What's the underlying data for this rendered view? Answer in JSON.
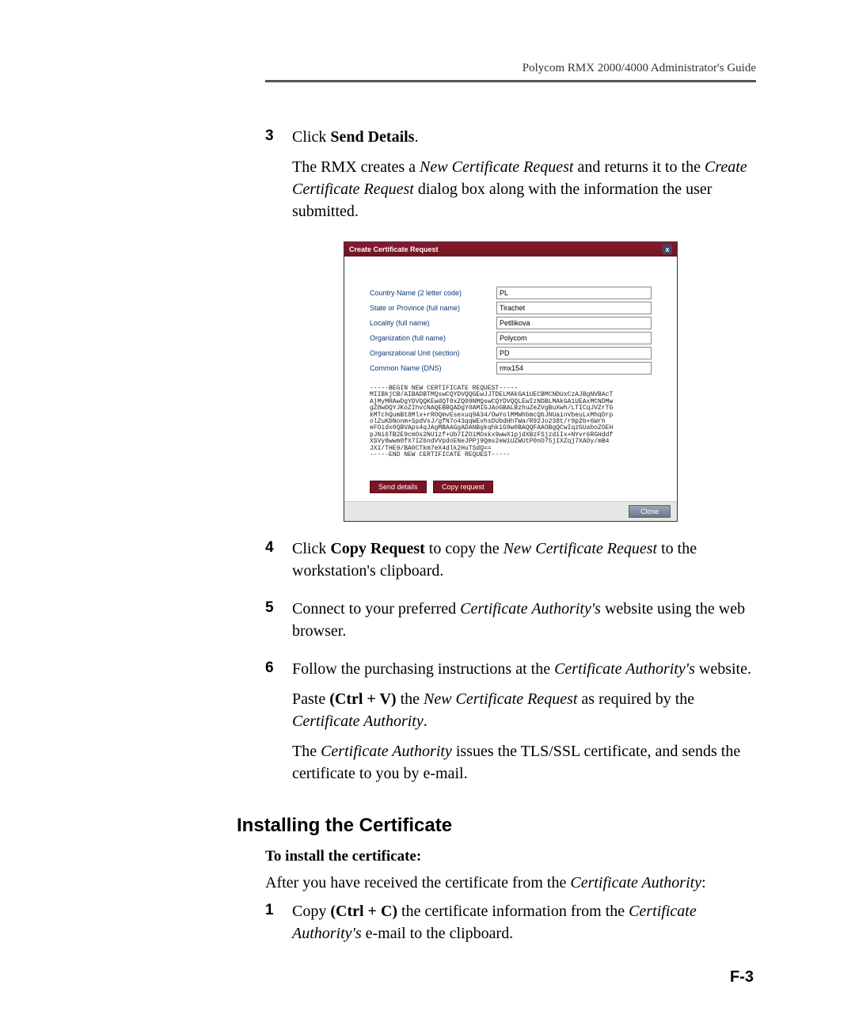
{
  "header": {
    "guide_title": "Polycom RMX 2000/4000 Administrator's Guide"
  },
  "steps_a": [
    {
      "num": "3",
      "parts": [
        {
          "pre": "Click ",
          "bold": "Send Details",
          "post": "."
        },
        {
          "plain_pre": "The RMX creates a ",
          "italic1": "New Certificate Request",
          "mid": " and returns it to the ",
          "italic2": "Create Certificate Request",
          "plain_post": " dialog box along with the information the user submitted."
        }
      ]
    }
  ],
  "dialog": {
    "title": "Create Certificate Request",
    "close_label": "x",
    "fields": [
      {
        "label": "Country Name (2 letter code)",
        "value": "PL"
      },
      {
        "label": "State or Province (full name)",
        "value": "Tirachet"
      },
      {
        "label": "Locality (full name)",
        "value": "Petllikova"
      },
      {
        "label": "Organization (full name)",
        "value": "Polycom"
      },
      {
        "label": "Organizational Unit (section)",
        "value": "PD"
      },
      {
        "label": "Common Name (DNS)",
        "value": "rmx154"
      }
    ],
    "cert_lines": [
      "-----BEGIN NEW CERTIFICATE REQUEST-----",
      "MIIBkjCB/AIBADBTMQswCQYDVQQGEwJJTDELMAkGA1UECBMCNDUxCzAJBgNVBAcT",
      "AjMyMRAwDgYDVQQKEwdQT0xZQ09NMQswCQYDVQQLEwIzNDBLMAkGA1UEAxMCNDMw",
      "gZ8wDQYJKoZIhvcNAQEBBQADgY0AMIGJAoGBALBzhuZeZVgBuXwh/LTICqJVZrTG",
      "kMTchQumBt8Mlx+rROQmvEsexuq9A34/OwYolMMWhbmcQbJNUainVbeuLxMhqDrp",
      "olZuKbNonm+SpdVsJ/gfN7o43qqWEvhsDUbdHhTWa/R92Jo238t/r9p2b+6Wrh",
      "eFOidx0QBVAps4qJAgMBAAGgADANBgkqhkiG9w0BAQQFAAOBgQCwIqzGUaboZOEH",
      "pJNi6TB2E9cmOs2NU1zf+Ub7IZOiMOskx9wwX1pjdXBzFSjzdiIx+NYvr6RGHddf",
      "XSVy8wwm0fX7IZ6ndVVpdoENeJPPj9Qms2eWiUZWUtP0nO75jIXZqj7XAOy/mB4",
      "JXI/THE9/BA0CTkm7eX4dlk2HuTSdQ==",
      "-----END NEW CERTIFICATE REQUEST-----"
    ],
    "buttons": {
      "send": "Send details",
      "copy": "Copy request",
      "close": "Close"
    }
  },
  "steps_b": [
    {
      "num": "4",
      "pre": "Click ",
      "bold": "Copy Request",
      "mid": " to copy the ",
      "italic": "New Certificate Request",
      "post": " to the workstation's clipboard."
    },
    {
      "num": "5",
      "pre": "Connect to your preferred ",
      "italic": "Certificate Authority's",
      "post": " website using the web browser."
    },
    {
      "num": "6",
      "line1_pre": "Follow the purchasing instructions at the ",
      "line1_italic": "Certificate Authority's",
      "line1_post": " website.",
      "line2_pre": "Paste ",
      "line2_bold": "(Ctrl + V)",
      "line2_mid": " the ",
      "line2_italic": "New Certificate Request",
      "line2_post": " as required by the ",
      "line2_italic2": "Certificate Authority",
      "line2_end": ".",
      "line3_pre": "The ",
      "line3_italic": "Certificate Authority",
      "line3_post": " issues the TLS/SSL certificate, and sends the certificate to you by e-mail."
    }
  ],
  "section": {
    "heading": "Installing the Certificate",
    "sub": "To install the certificate:",
    "para_pre": "After you have received the certificate from the ",
    "para_italic": "Certificate Authority",
    "para_post": ":"
  },
  "steps_c": [
    {
      "num": "1",
      "pre": "Copy ",
      "bold": "(Ctrl + C)",
      "mid": " the certificate information from the ",
      "italic": "Certificate Authority's",
      "post": " e-mail to the clipboard."
    }
  ],
  "page_number": "F-3"
}
